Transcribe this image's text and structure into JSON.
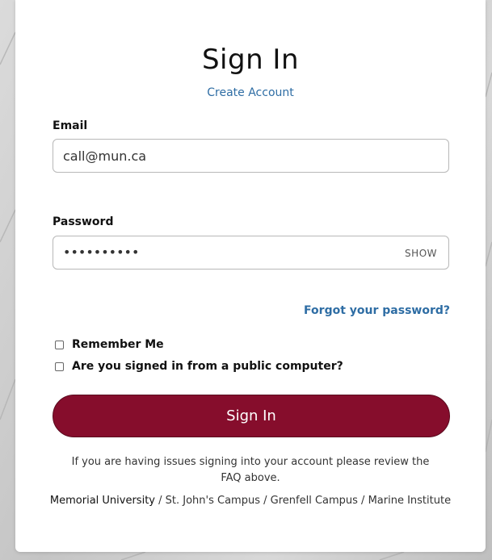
{
  "page": {
    "title": "Sign In",
    "create_account_link": "Create Account"
  },
  "email": {
    "label": "Email",
    "value": "call@mun.ca"
  },
  "password": {
    "label": "Password",
    "masked_value": "••••••••••",
    "show_label": "SHOW"
  },
  "forgot_link": "Forgot your password?",
  "options": {
    "remember_me": {
      "label": "Remember Me",
      "checked": false
    },
    "public_computer": {
      "label": "Are you signed in from a public computer?",
      "checked": false
    }
  },
  "signin_button": "Sign In",
  "help": {
    "text_before": "If you are having issues signing into your account please review the ",
    "faq_link": "FAQ",
    "text_after": " above."
  },
  "footer": {
    "university": "Memorial University",
    "separator": " / ",
    "campus_st_johns": "St. John's Campus",
    "campus_grenfell": "Grenfell Campus",
    "campus_marine": "Marine Institute"
  },
  "colors": {
    "brand_maroon": "#860d2c",
    "link_blue": "#2e6da4"
  }
}
